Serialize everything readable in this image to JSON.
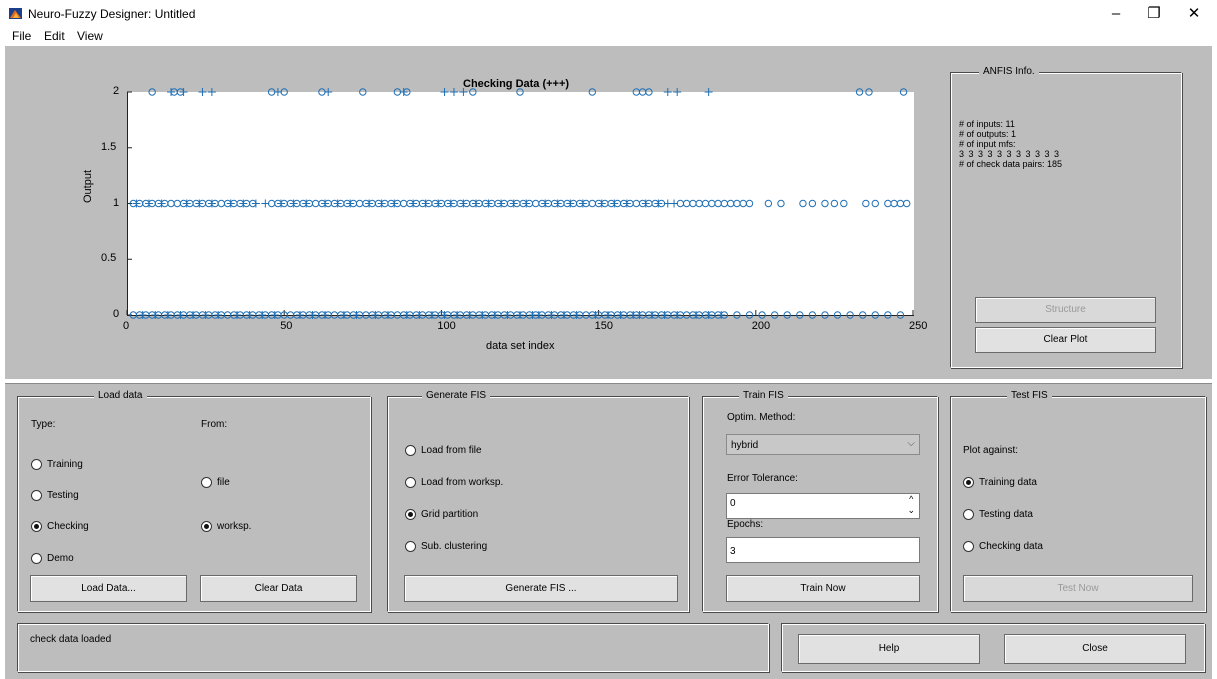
{
  "window": {
    "title": "Neuro-Fuzzy Designer: Untitled",
    "minimize": "–",
    "restore": "❐",
    "close": "✕",
    "icon": "matlab-icon"
  },
  "menu": [
    "File",
    "Edit",
    "View"
  ],
  "chart_data": {
    "type": "scatter",
    "title": "Checking Data (+++)",
    "xlabel": "data set index",
    "ylabel": "Output",
    "xlim": [
      0,
      250
    ],
    "ylim": [
      0,
      2
    ],
    "xticks": [
      "0",
      "50",
      "100",
      "150",
      "200",
      "250"
    ],
    "yticks": [
      "0",
      "0.5",
      "1",
      "1.5",
      "2"
    ],
    "x_tick_values": [
      0,
      50,
      100,
      150,
      200,
      250
    ],
    "y_tick_values": [
      0,
      0.5,
      1,
      1.5,
      2
    ],
    "color": "#1f6fb5",
    "series": [
      {
        "marker": "circle",
        "y": 2,
        "x": [
          8,
          15,
          17,
          46,
          50,
          62,
          75,
          86,
          89,
          110,
          125,
          148,
          162,
          164,
          166,
          233,
          236,
          247
        ]
      },
      {
        "marker": "plus",
        "y": 2,
        "x": [
          14,
          18,
          24,
          27,
          48,
          64,
          88,
          101,
          104,
          107,
          172,
          175,
          185
        ]
      },
      {
        "marker": "circle",
        "y": 1,
        "x": [
          2,
          4,
          6,
          8,
          10,
          12,
          14,
          16,
          18,
          20,
          22,
          24,
          26,
          28,
          30,
          32,
          34,
          36,
          38,
          40,
          46,
          48,
          50,
          52,
          54,
          56,
          58,
          60,
          62,
          64,
          66,
          68,
          70,
          72,
          74,
          76,
          78,
          80,
          82,
          84,
          86,
          88,
          90,
          92,
          94,
          96,
          98,
          100,
          102,
          104,
          106,
          108,
          110,
          112,
          114,
          116,
          118,
          120,
          122,
          124,
          126,
          128,
          130,
          132,
          134,
          136,
          138,
          140,
          142,
          144,
          146,
          148,
          150,
          152,
          154,
          156,
          158,
          160,
          162,
          164,
          166,
          168,
          170,
          176,
          178,
          180,
          182,
          184,
          186,
          188,
          190,
          192,
          194,
          196,
          198,
          204,
          208,
          215,
          218,
          222,
          225,
          228,
          235,
          238,
          242,
          244,
          246,
          248
        ]
      },
      {
        "marker": "plus",
        "y": 1,
        "x": [
          3,
          7,
          11,
          19,
          23,
          27,
          33,
          37,
          41,
          44,
          49,
          53,
          57,
          63,
          67,
          71,
          77,
          81,
          85,
          91,
          95,
          99,
          103,
          107,
          111,
          115,
          119,
          123,
          127,
          133,
          137,
          141,
          145,
          151,
          155,
          159,
          165,
          169,
          172,
          174
        ]
      },
      {
        "marker": "circle",
        "y": 0,
        "x": [
          2,
          4,
          6,
          8,
          10,
          12,
          14,
          16,
          18,
          20,
          22,
          24,
          26,
          28,
          30,
          32,
          34,
          36,
          38,
          40,
          42,
          44,
          46,
          48,
          50,
          52,
          54,
          56,
          58,
          60,
          62,
          64,
          66,
          68,
          70,
          72,
          74,
          76,
          78,
          80,
          82,
          84,
          86,
          88,
          90,
          92,
          94,
          96,
          98,
          100,
          102,
          104,
          106,
          108,
          110,
          112,
          114,
          116,
          118,
          120,
          122,
          124,
          126,
          128,
          130,
          132,
          134,
          136,
          138,
          140,
          142,
          144,
          146,
          148,
          150,
          152,
          154,
          156,
          158,
          160,
          162,
          164,
          166,
          168,
          170,
          172,
          174,
          176,
          178,
          180,
          182,
          184,
          186,
          188,
          190,
          194,
          198,
          202,
          206,
          210,
          214,
          218,
          222,
          226,
          230,
          234,
          238,
          242,
          246
        ]
      },
      {
        "marker": "plus",
        "y": 0,
        "x": [
          5,
          9,
          13,
          17,
          21,
          25,
          29,
          35,
          39,
          43,
          47,
          55,
          59,
          63,
          69,
          73,
          79,
          83,
          89,
          93,
          97,
          101,
          105,
          109,
          113,
          117,
          121,
          125,
          129,
          131,
          135,
          139,
          143,
          149,
          153,
          157,
          161,
          163,
          167,
          171,
          175,
          181,
          185,
          189
        ]
      }
    ]
  },
  "anfis": {
    "title": "ANFIS Info.",
    "lines": [
      "# of inputs: 11",
      "# of outputs: 1",
      "# of input mfs:",
      "3 3 3 3 3 3 3 3 3 3 3",
      "# of check data pairs: 185"
    ],
    "structure": "Structure",
    "clear_plot": "Clear Plot"
  },
  "load_data": {
    "title": "Load data",
    "type_label": "Type:",
    "from_label": "From:",
    "types": [
      "Training",
      "Testing",
      "Checking",
      "Demo"
    ],
    "selected_type": "Checking",
    "sources": [
      "file",
      "worksp."
    ],
    "selected_source": "worksp.",
    "load_button": "Load Data...",
    "clear_button": "Clear Data"
  },
  "generate": {
    "title": "Generate FIS",
    "options": [
      "Load from file",
      "Load from worksp.",
      "Grid partition",
      "Sub. clustering"
    ],
    "selected": "Grid partition",
    "button": "Generate FIS ..."
  },
  "train": {
    "title": "Train FIS",
    "method_label": "Optim. Method:",
    "method": "hybrid",
    "tol_label": "Error Tolerance:",
    "tol": "0",
    "epochs_label": "Epochs:",
    "epochs": "3",
    "button": "Train Now"
  },
  "test": {
    "title": "Test FIS",
    "plot_label": "Plot against:",
    "options": [
      "Training data",
      "Testing data",
      "Checking data"
    ],
    "selected": "Training data",
    "button": "Test Now"
  },
  "status": {
    "message": "check data loaded",
    "help": "Help",
    "close": "Close"
  }
}
